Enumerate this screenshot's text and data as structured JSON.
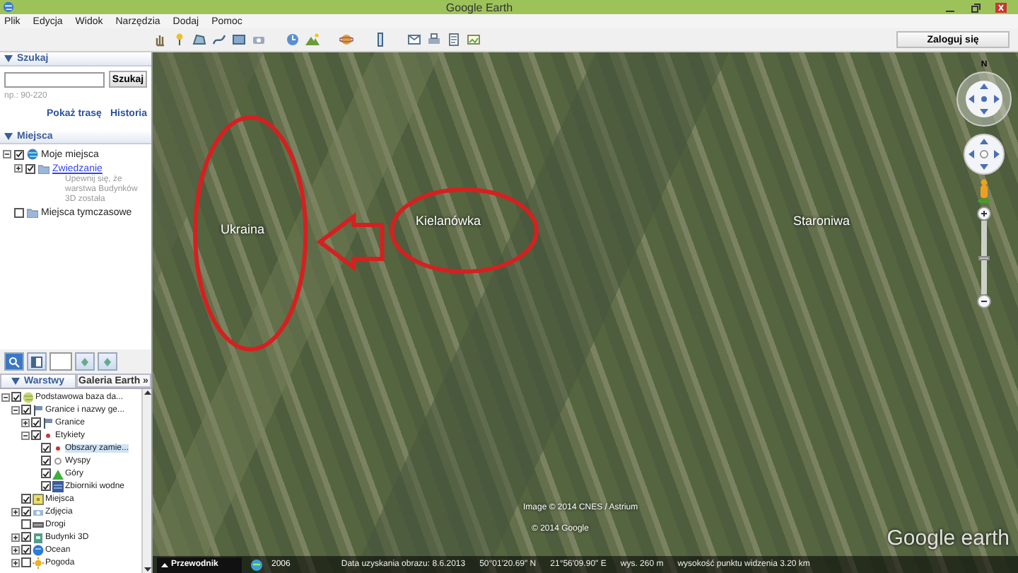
{
  "window": {
    "title": "Google Earth"
  },
  "menu": [
    "Plik",
    "Edycja",
    "Widok",
    "Narzędzia",
    "Dodaj",
    "Pomoc"
  ],
  "toolbar": {
    "sign_in": "Zaloguj się"
  },
  "search_panel": {
    "header": "Szukaj",
    "button": "Szukaj",
    "hint": "np.: 90-220",
    "links": [
      "Pokaż trasę",
      "Historia"
    ]
  },
  "places_panel": {
    "header": "Miejsca",
    "items": [
      {
        "label": "Moje miejsca",
        "kind": "globe",
        "checked": true,
        "expanded": true,
        "children": [
          {
            "label": "Zwiedzanie",
            "kind": "folder",
            "checked": true,
            "expanded": false,
            "link": true,
            "description": "Upewnij się, że warstwa Budynków 3D została"
          }
        ]
      },
      {
        "label": "Miejsca tymczasowe",
        "kind": "folder",
        "checked": false
      }
    ]
  },
  "layers_panel": {
    "tabs": [
      {
        "label": "Warstwy",
        "selected": true
      },
      {
        "label": "Galeria Earth »",
        "selected": false
      }
    ],
    "items": [
      {
        "label": "Podstawowa baza da...",
        "kind": "database",
        "checked": true,
        "expanded": true,
        "selected": false,
        "children": [
          {
            "label": "Granice i nazwy ge...",
            "kind": "flag",
            "checked": true,
            "expanded": true,
            "selected": false,
            "children": [
              {
                "label": "Granice",
                "kind": "flag",
                "checked": true,
                "expanded": false,
                "selected": false
              },
              {
                "label": "Etykiety",
                "kind": "dot",
                "checked": true,
                "expanded": true,
                "selected": false,
                "children": [
                  {
                    "label": "Obszary zamie...",
                    "kind": "dot",
                    "checked": true,
                    "selected": true
                  },
                  {
                    "label": "Wyspy",
                    "kind": "ring",
                    "checked": true,
                    "selected": false
                  },
                  {
                    "label": "Góry",
                    "kind": "mountain",
                    "checked": true,
                    "selected": false
                  },
                  {
                    "label": "Zbiorniki wodne",
                    "kind": "water",
                    "checked": true,
                    "selected": false
                  }
                ]
              }
            ]
          },
          {
            "label": "Miejsca",
            "kind": "place",
            "checked": true,
            "selected": false
          },
          {
            "label": "Zdjęcia",
            "kind": "photo",
            "checked": true,
            "expanded": false,
            "selected": false
          },
          {
            "label": "Drogi",
            "kind": "road",
            "checked": false,
            "selected": false
          },
          {
            "label": "Budynki 3D",
            "kind": "building",
            "checked": true,
            "expanded": false,
            "selected": false
          },
          {
            "label": "Ocean",
            "kind": "ocean",
            "checked": true,
            "expanded": false,
            "selected": false
          },
          {
            "label": "Pogoda",
            "kind": "weather",
            "checked": false,
            "expanded": false,
            "selected": false
          }
        ]
      }
    ]
  },
  "map": {
    "labels": [
      "Ukraina",
      "Kielanówka",
      "Staroniwa"
    ],
    "compass_north": "N",
    "zoom": {
      "level": 0.5
    },
    "attribution": [
      "Image © 2014 CNES / Astrium",
      "© 2014 Google"
    ],
    "logo": "Google earth"
  },
  "status_bar": {
    "guide": "Przewodnik",
    "year": "2006",
    "fields": [
      "Data uzyskania obrazu: 8.6.2013",
      "50°01'20.69\" N",
      "21°56'09.90\" E",
      "wys. 260 m",
      "wysokość punktu widzenia 3.20 km"
    ]
  }
}
